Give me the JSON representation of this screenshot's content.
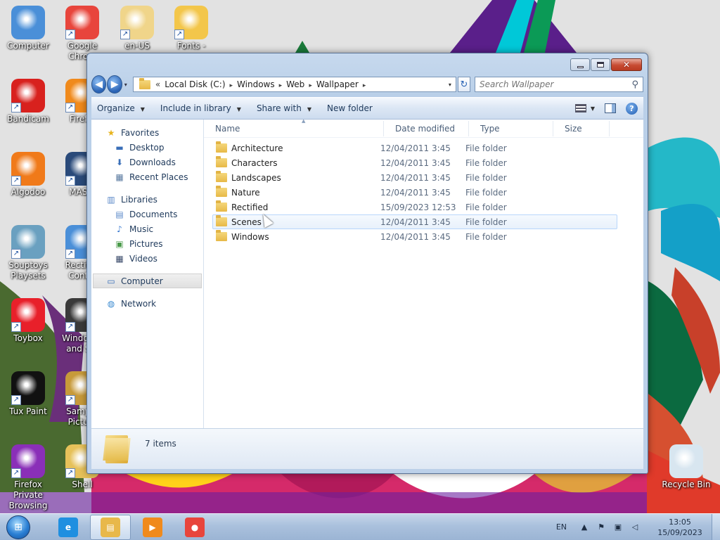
{
  "desktop": {
    "icons": [
      {
        "label": "Computer",
        "icon": "computer-icon",
        "color": "#4a8fd8"
      },
      {
        "label": "Google Chro...",
        "icon": "chrome-icon",
        "color": "#e8453c"
      },
      {
        "label": "en-US",
        "icon": "folder-document-icon",
        "color": "#f0d58a"
      },
      {
        "label": "Fonts -",
        "icon": "fonts-folder-icon",
        "color": "#f3c64a"
      },
      {
        "label": "Bandicam",
        "icon": "bandicam-icon",
        "color": "#d8211e"
      },
      {
        "label": "Firef...",
        "icon": "firefox-icon",
        "color": "#f08a1c"
      },
      {
        "label": "Algodoo",
        "icon": "algodoo-icon",
        "color": "#f07a1a"
      },
      {
        "label": "MAS...",
        "icon": "mas-icon",
        "color": "#2a4a7a"
      },
      {
        "label": "Souptoys Playsets",
        "icon": "souptoys-icon",
        "color": "#6aa0c0"
      },
      {
        "label": "Rectifi... Cont...",
        "icon": "rectified-icon",
        "color": "#4a8fd8"
      },
      {
        "label": "Toybox",
        "icon": "toybox-icon",
        "color": "#e8202a"
      },
      {
        "label": "Window... and S...",
        "icon": "windows-app-icon",
        "color": "#3a3a3a"
      },
      {
        "label": "Tux Paint",
        "icon": "tux-icon",
        "color": "#111111"
      },
      {
        "label": "Samp... Pictu...",
        "icon": "sample-pictures-icon",
        "color": "#c79a3a"
      },
      {
        "label": "Firefox Private Browsing",
        "icon": "firefox-private-icon",
        "color": "#8a2fb8"
      },
      {
        "label": "Shell",
        "icon": "shell-folder-icon",
        "color": "#e6c15a"
      },
      {
        "label": "Recycle Bin",
        "icon": "recycle-bin-icon",
        "color": "#d8e6f0"
      }
    ]
  },
  "window": {
    "title_buttons": {
      "minimize": "minimize",
      "maximize": "maximize",
      "close": "✕"
    },
    "nav": {
      "back": "◀",
      "forward": "▶",
      "history": "▾"
    },
    "address": {
      "overflow": "«",
      "crumbs": [
        "Local Disk (C:)",
        "Windows",
        "Web",
        "Wallpaper"
      ],
      "separator": "▸",
      "dropdown": "▾"
    },
    "refresh": "↻",
    "search": {
      "placeholder": "Search Wallpaper",
      "icon": "⚲"
    },
    "commands": [
      {
        "label": "Organize",
        "dropdown": true
      },
      {
        "label": "Include in library",
        "dropdown": true
      },
      {
        "label": "Share with",
        "dropdown": true
      },
      {
        "label": "New folder",
        "dropdown": false
      }
    ],
    "help": "?",
    "navpane": {
      "groups": [
        {
          "label": "Favorites",
          "icon": "star-icon",
          "glyph": "★",
          "color": "#e8b41e",
          "items": [
            {
              "label": "Desktop",
              "icon": "desktop-icon",
              "glyph": "▬",
              "color": "#3a6fb8"
            },
            {
              "label": "Downloads",
              "icon": "downloads-icon",
              "glyph": "⬇",
              "color": "#3a6fb8"
            },
            {
              "label": "Recent Places",
              "icon": "recent-places-icon",
              "glyph": "▦",
              "color": "#5a7aa0"
            }
          ]
        },
        {
          "label": "Libraries",
          "icon": "libraries-icon",
          "glyph": "▥",
          "color": "#5a88c8",
          "items": [
            {
              "label": "Documents",
              "icon": "documents-icon",
              "glyph": "▤",
              "color": "#5a88c8"
            },
            {
              "label": "Music",
              "icon": "music-icon",
              "glyph": "♪",
              "color": "#3a7ad0"
            },
            {
              "label": "Pictures",
              "icon": "pictures-icon",
              "glyph": "▣",
              "color": "#4a9a4a"
            },
            {
              "label": "Videos",
              "icon": "videos-icon",
              "glyph": "▦",
              "color": "#3a4a6a"
            }
          ]
        },
        {
          "label": "Computer",
          "icon": "computer-icon",
          "glyph": "▭",
          "color": "#3a6fb8",
          "selected": true,
          "items": []
        },
        {
          "label": "Network",
          "icon": "network-icon",
          "glyph": "◍",
          "color": "#3a8ad0",
          "items": []
        }
      ]
    },
    "columns": [
      {
        "label": "Name",
        "width": 256
      },
      {
        "label": "Date modified",
        "width": 121
      },
      {
        "label": "Type",
        "width": 120
      },
      {
        "label": "Size",
        "width": 80
      }
    ],
    "sort_arrow": "▲",
    "files": [
      {
        "name": "Architecture",
        "date": "12/04/2011 3:45",
        "type": "File folder"
      },
      {
        "name": "Characters",
        "date": "12/04/2011 3:45",
        "type": "File folder"
      },
      {
        "name": "Landscapes",
        "date": "12/04/2011 3:45",
        "type": "File folder"
      },
      {
        "name": "Nature",
        "date": "12/04/2011 3:45",
        "type": "File folder"
      },
      {
        "name": "Rectified",
        "date": "15/09/2023 12:53",
        "type": "File folder"
      },
      {
        "name": "Scenes",
        "date": "12/04/2011 3:45",
        "type": "File folder",
        "hover": true
      },
      {
        "name": "Windows",
        "date": "12/04/2011 3:45",
        "type": "File folder"
      }
    ],
    "details": {
      "count": "7 items"
    }
  },
  "taskbar": {
    "start": "⊞",
    "items": [
      {
        "name": "internet-explorer",
        "icon": "internet-explorer-icon",
        "glyph": "e",
        "color": "#1f8fe0",
        "active": false
      },
      {
        "name": "windows-explorer",
        "icon": "windows-explorer-icon",
        "glyph": "▤",
        "color": "#e8b84a",
        "active": true
      },
      {
        "name": "media-player",
        "icon": "media-player-icon",
        "glyph": "▶",
        "color": "#f08a1c",
        "active": false
      },
      {
        "name": "google-chrome",
        "icon": "chrome-icon",
        "glyph": "●",
        "color": "#e8453c",
        "active": false
      }
    ],
    "tray": {
      "lang": "EN",
      "icons": [
        {
          "name": "show-hidden-icon",
          "glyph": "▲"
        },
        {
          "name": "action-center-icon",
          "glyph": "⚑"
        },
        {
          "name": "network-tray-icon",
          "glyph": "▣"
        },
        {
          "name": "volume-muted-icon",
          "glyph": "◁"
        }
      ],
      "time": "13:05",
      "date": "15/09/2023"
    }
  }
}
